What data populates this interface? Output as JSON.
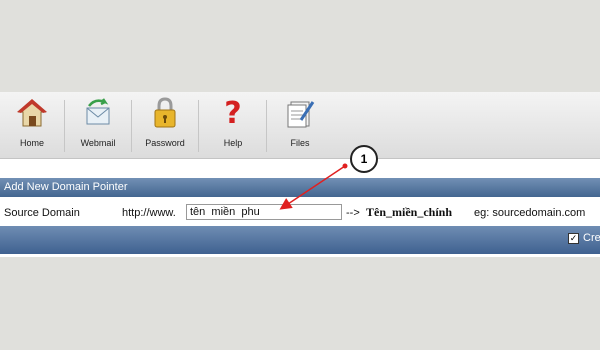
{
  "toolbar": {
    "items": [
      {
        "label": "Home",
        "icon": "home-icon"
      },
      {
        "label": "Webmail",
        "icon": "webmail-icon"
      },
      {
        "label": "Password",
        "icon": "lock-icon"
      },
      {
        "label": "Help",
        "icon": "help-icon"
      },
      {
        "label": "Files",
        "icon": "files-icon"
      }
    ]
  },
  "section": {
    "title": "Add New Domain Pointer"
  },
  "form": {
    "source_label": "Source Domain",
    "prefix": "http://www.",
    "source_value": "tên  miền  phu",
    "arrow_text": "-->",
    "target_text": "Tên_miền_chính",
    "example": "eg: sourcedomain.com"
  },
  "footer": {
    "checkbox_checked": "✓",
    "create_label": "Cre"
  },
  "callout": {
    "number": "1"
  },
  "colors": {
    "header_bar": "#436690",
    "arrow": "#e02020"
  }
}
